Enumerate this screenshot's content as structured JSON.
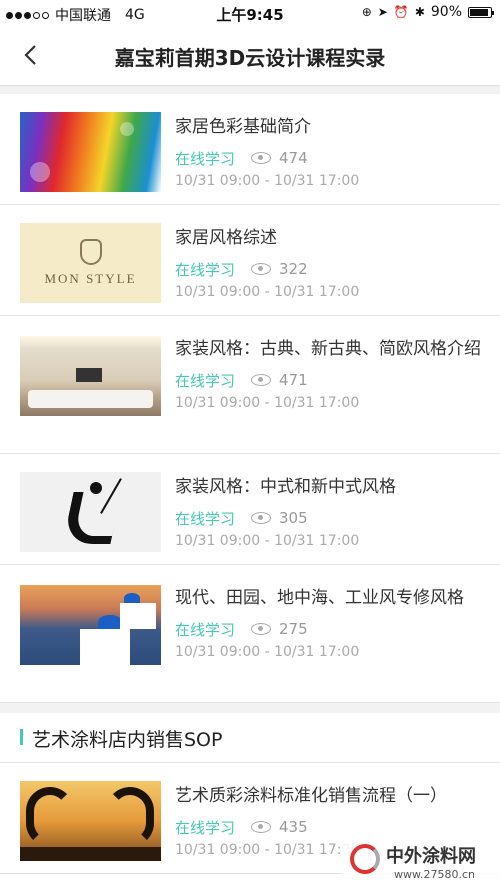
{
  "status_bar": {
    "carrier": "中国联通",
    "network": "4G",
    "time": "上午9:45",
    "battery": "90%",
    "battery_level": 0.9
  },
  "nav": {
    "back_icon": "chevron-left-icon",
    "title": "嘉宝莉首期3D云设计课程实录"
  },
  "courses": [
    {
      "title": "家居色彩基础简介",
      "mode": "在线学习",
      "views": "474",
      "time": "10/31 09:00 - 10/31 17:00"
    },
    {
      "title": "家居风格综述",
      "mode": "在线学习",
      "views": "322",
      "time": "10/31 09:00 - 10/31 17:00",
      "thumb_brand": "MON STYLE"
    },
    {
      "title": "家装风格：古典、新古典、简欧风格介绍",
      "mode": "在线学习",
      "views": "471",
      "time": "10/31 09:00 - 10/31 17:00"
    },
    {
      "title": "家装风格：中式和新中式风格",
      "mode": "在线学习",
      "views": "305",
      "time": "10/31 09:00 - 10/31 17:00"
    },
    {
      "title": "现代、田园、地中海、工业风专修风格",
      "mode": "在线学习",
      "views": "275",
      "time": "10/31 09:00 - 10/31 17:00"
    }
  ],
  "section": {
    "title": "艺术涂料店内销售SOP",
    "courses": [
      {
        "title": "艺术质彩涂料标准化销售流程（一）",
        "mode": "在线学习",
        "views": "435",
        "time": "10/31 09:00 - 10/31 17:00"
      }
    ]
  },
  "watermark": {
    "name": "中外涂料网",
    "url": "www.27580.cn"
  },
  "colors": {
    "accent": "#45c9b3",
    "muted": "#aaaaaa",
    "divider": "#e3e3e3"
  }
}
